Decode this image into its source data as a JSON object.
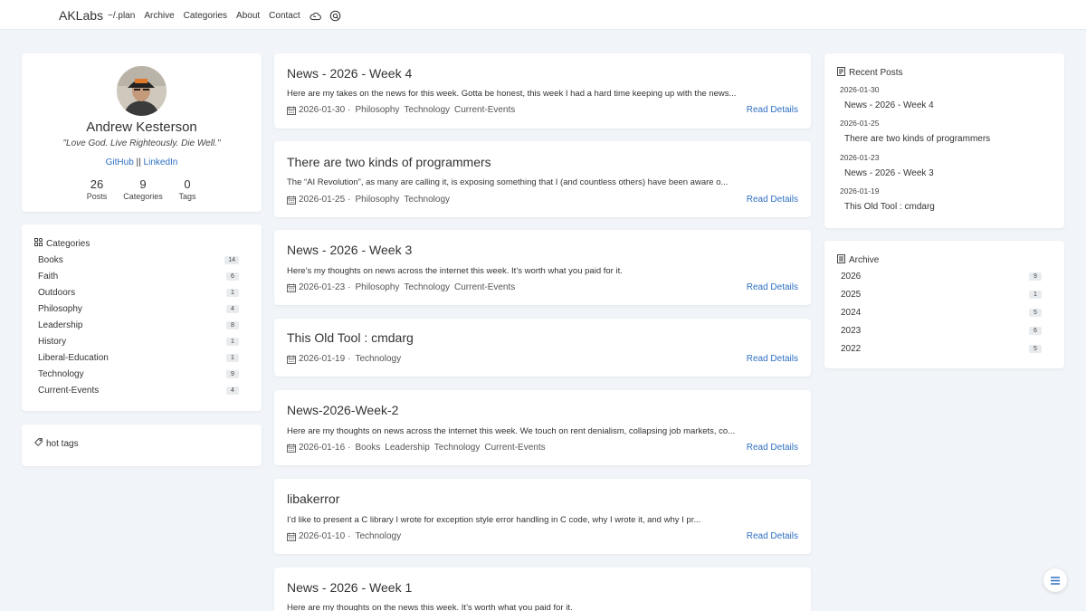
{
  "colors": {
    "accent": "#2f6fc2",
    "background": "#f1f4f8",
    "card": "#ffffff",
    "badge": "#e9ecef"
  },
  "nav": {
    "brand": "AKLabs",
    "links": [
      "~/.plan",
      "Archive",
      "Categories",
      "About",
      "Contact"
    ],
    "icons": [
      "cloud-icon",
      "search-icon"
    ]
  },
  "profile": {
    "name": "Andrew Kesterson",
    "quote": "\"Love God. Live Righteously. Die Well.\"",
    "github": "GitHub",
    "separator": "||",
    "linkedin": "LinkedIn",
    "stats": [
      {
        "value": "26",
        "label": "Posts"
      },
      {
        "value": "9",
        "label": "Categories"
      },
      {
        "value": "0",
        "label": "Tags"
      }
    ]
  },
  "categories": {
    "title": "Categories",
    "items": [
      {
        "name": "Books",
        "count": "14"
      },
      {
        "name": "Faith",
        "count": "6"
      },
      {
        "name": "Outdoors",
        "count": "1"
      },
      {
        "name": "Philosophy",
        "count": "4"
      },
      {
        "name": "Leadership",
        "count": "8"
      },
      {
        "name": "History",
        "count": "1"
      },
      {
        "name": "Liberal-Education",
        "count": "1"
      },
      {
        "name": "Technology",
        "count": "9"
      },
      {
        "name": "Current-Events",
        "count": "4"
      }
    ]
  },
  "hot_tags": {
    "title": "hot tags"
  },
  "posts": [
    {
      "title": "News - 2026 - Week 4",
      "excerpt": "Here are my takes on the news for this week. Gotta be honest, this week I had a hard time keeping up with the news...",
      "date": "2026-01-30",
      "sep": "·",
      "cats": [
        "Philosophy",
        "Technology",
        "Current-Events"
      ],
      "read": "Read Details"
    },
    {
      "title": "There are two kinds of programmers",
      "excerpt": "The “AI Revolution”, as many are calling it, is exposing something that I (and countless others) have been aware o...",
      "date": "2026-01-25",
      "sep": "·",
      "cats": [
        "Philosophy",
        "Technology"
      ],
      "read": "Read Details"
    },
    {
      "title": "News - 2026 - Week 3",
      "excerpt": "Here’s my thoughts on news across the internet this week. It’s worth what you paid for it.",
      "date": "2026-01-23",
      "sep": "·",
      "cats": [
        "Philosophy",
        "Technology",
        "Current-Events"
      ],
      "read": "Read Details"
    },
    {
      "title": "This Old Tool : cmdarg",
      "excerpt": "",
      "date": "2026-01-19",
      "sep": "·",
      "cats": [
        "Technology"
      ],
      "read": "Read Details"
    },
    {
      "title": "News-2026-Week-2",
      "excerpt": "Here are my thoughts on news across the internet this week. We touch on rent denialism, collapsing job markets, co...",
      "date": "2026-01-16",
      "sep": "·",
      "cats": [
        "Books",
        "Leadership",
        "Technology",
        "Current-Events"
      ],
      "read": "Read Details"
    },
    {
      "title": "libakerror",
      "excerpt": "I’d like to present a C library I wrote for exception style error handling in C code, why I wrote it, and why I pr...",
      "date": "2026-01-10",
      "sep": "·",
      "cats": [
        "Technology"
      ],
      "read": "Read Details"
    },
    {
      "title": "News - 2026 - Week 1",
      "excerpt": "Here are my thoughts on the news this week. It’s worth what you paid for it."
    }
  ],
  "recent": {
    "title": "Recent Posts",
    "items": [
      {
        "date": "2026-01-30",
        "title": "News - 2026 - Week 4"
      },
      {
        "date": "2026-01-25",
        "title": "There are two kinds of programmers"
      },
      {
        "date": "2026-01-23",
        "title": "News - 2026 - Week 3"
      },
      {
        "date": "2026-01-19",
        "title": "This Old Tool : cmdarg"
      }
    ]
  },
  "archive": {
    "title": "Archive",
    "items": [
      {
        "year": "2026",
        "count": "9"
      },
      {
        "year": "2025",
        "count": "1"
      },
      {
        "year": "2024",
        "count": "5"
      },
      {
        "year": "2023",
        "count": "6"
      },
      {
        "year": "2022",
        "count": "5"
      }
    ]
  },
  "fab": {
    "icon": "menu-icon"
  }
}
